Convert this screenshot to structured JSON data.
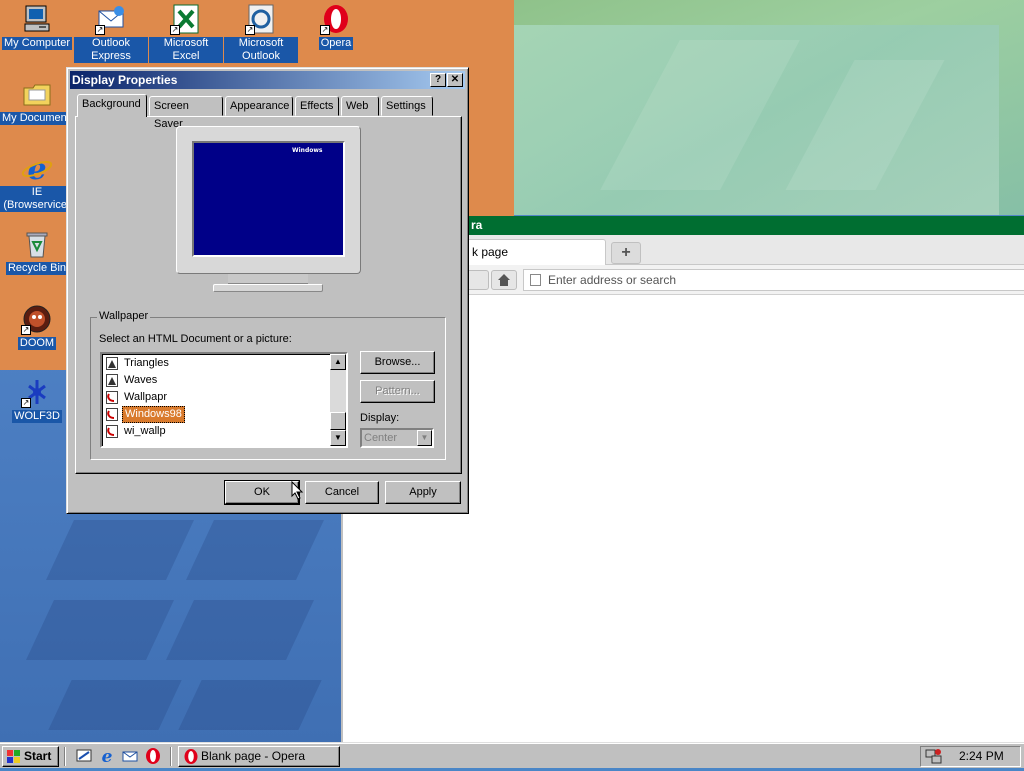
{
  "desktop_icons": [
    {
      "id": "my-computer",
      "label": "My Computer"
    },
    {
      "id": "outlook-express",
      "label": "Outlook Express"
    },
    {
      "id": "microsoft-excel",
      "label": "Microsoft Excel"
    },
    {
      "id": "microsoft-outlook",
      "label": "Microsoft Outlook"
    },
    {
      "id": "opera",
      "label": "Opera"
    },
    {
      "id": "my-documents",
      "label": "My Documents"
    },
    {
      "id": "ie",
      "label": "IE (Browservice)"
    },
    {
      "id": "recycle-bin",
      "label": "Recycle Bin"
    },
    {
      "id": "doom",
      "label": "DOOM"
    },
    {
      "id": "wolf3d",
      "label": "WOLF3D"
    }
  ],
  "opera": {
    "title": "ra",
    "tab_label": "k page",
    "new_tab_symbol": "+",
    "address_placeholder": "Enter address or search"
  },
  "dialog": {
    "title": "Display Properties",
    "help_symbol": "?",
    "close_symbol": "✕",
    "tabs": [
      "Background",
      "Screen Saver",
      "Appearance",
      "Effects",
      "Web",
      "Settings"
    ],
    "active_tab": "Background",
    "preview_logo_text": "Windows",
    "wallpaper_group_title": "Wallpaper",
    "select_prompt": "Select an HTML Document or a picture:",
    "wallpapers": [
      {
        "name": "Triangles",
        "kind": "bitmap"
      },
      {
        "name": "Waves",
        "kind": "bitmap"
      },
      {
        "name": "Wallpapr",
        "kind": "html"
      },
      {
        "name": "Windows98",
        "kind": "html",
        "selected": true
      },
      {
        "name": "wi_wallp",
        "kind": "html"
      }
    ],
    "browse_label": "Browse...",
    "pattern_label": "Pattern...",
    "display_label": "Display:",
    "display_value": "Center",
    "ok_label": "OK",
    "cancel_label": "Cancel",
    "apply_label": "Apply"
  },
  "taskbar": {
    "start_label": "Start",
    "task_label": "Blank page - Opera",
    "clock": "2:24 PM"
  },
  "colors": {
    "selection_highlight": "#d97a2c",
    "opera_titlebar": "#006e31",
    "dialog_caption": "#0a246a",
    "wallpaper_orange": "#de8a4c",
    "wallpaper_green": "#9dcfa0",
    "wallpaper_blue": "#4a7cc0",
    "monitor_screen": "#000088"
  }
}
